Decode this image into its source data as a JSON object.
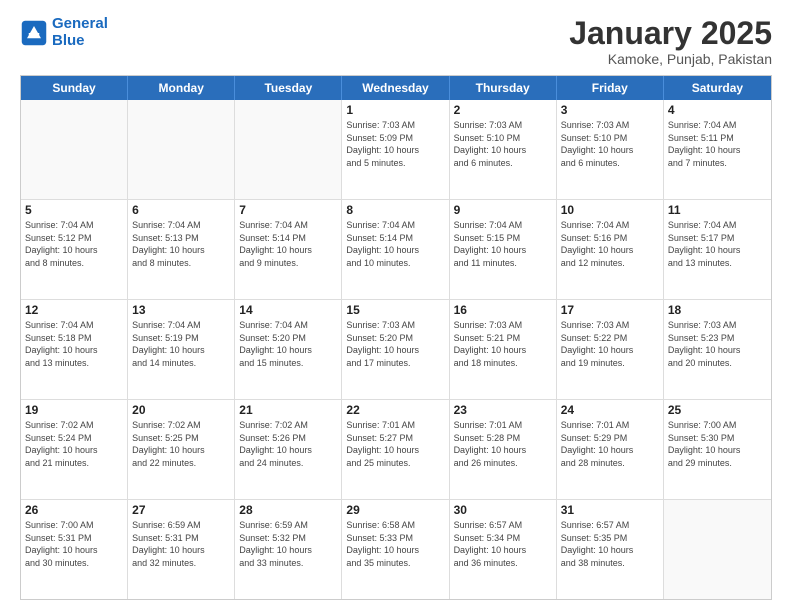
{
  "header": {
    "logo_line1": "General",
    "logo_line2": "Blue",
    "title": "January 2025",
    "subtitle": "Kamoke, Punjab, Pakistan"
  },
  "weekdays": [
    "Sunday",
    "Monday",
    "Tuesday",
    "Wednesday",
    "Thursday",
    "Friday",
    "Saturday"
  ],
  "weeks": [
    [
      {
        "day": "",
        "info": "",
        "empty": true
      },
      {
        "day": "",
        "info": "",
        "empty": true
      },
      {
        "day": "",
        "info": "",
        "empty": true
      },
      {
        "day": "1",
        "info": "Sunrise: 7:03 AM\nSunset: 5:09 PM\nDaylight: 10 hours\nand 5 minutes.",
        "empty": false
      },
      {
        "day": "2",
        "info": "Sunrise: 7:03 AM\nSunset: 5:10 PM\nDaylight: 10 hours\nand 6 minutes.",
        "empty": false
      },
      {
        "day": "3",
        "info": "Sunrise: 7:03 AM\nSunset: 5:10 PM\nDaylight: 10 hours\nand 6 minutes.",
        "empty": false
      },
      {
        "day": "4",
        "info": "Sunrise: 7:04 AM\nSunset: 5:11 PM\nDaylight: 10 hours\nand 7 minutes.",
        "empty": false
      }
    ],
    [
      {
        "day": "5",
        "info": "Sunrise: 7:04 AM\nSunset: 5:12 PM\nDaylight: 10 hours\nand 8 minutes.",
        "empty": false
      },
      {
        "day": "6",
        "info": "Sunrise: 7:04 AM\nSunset: 5:13 PM\nDaylight: 10 hours\nand 8 minutes.",
        "empty": false
      },
      {
        "day": "7",
        "info": "Sunrise: 7:04 AM\nSunset: 5:14 PM\nDaylight: 10 hours\nand 9 minutes.",
        "empty": false
      },
      {
        "day": "8",
        "info": "Sunrise: 7:04 AM\nSunset: 5:14 PM\nDaylight: 10 hours\nand 10 minutes.",
        "empty": false
      },
      {
        "day": "9",
        "info": "Sunrise: 7:04 AM\nSunset: 5:15 PM\nDaylight: 10 hours\nand 11 minutes.",
        "empty": false
      },
      {
        "day": "10",
        "info": "Sunrise: 7:04 AM\nSunset: 5:16 PM\nDaylight: 10 hours\nand 12 minutes.",
        "empty": false
      },
      {
        "day": "11",
        "info": "Sunrise: 7:04 AM\nSunset: 5:17 PM\nDaylight: 10 hours\nand 13 minutes.",
        "empty": false
      }
    ],
    [
      {
        "day": "12",
        "info": "Sunrise: 7:04 AM\nSunset: 5:18 PM\nDaylight: 10 hours\nand 13 minutes.",
        "empty": false
      },
      {
        "day": "13",
        "info": "Sunrise: 7:04 AM\nSunset: 5:19 PM\nDaylight: 10 hours\nand 14 minutes.",
        "empty": false
      },
      {
        "day": "14",
        "info": "Sunrise: 7:04 AM\nSunset: 5:20 PM\nDaylight: 10 hours\nand 15 minutes.",
        "empty": false
      },
      {
        "day": "15",
        "info": "Sunrise: 7:03 AM\nSunset: 5:20 PM\nDaylight: 10 hours\nand 17 minutes.",
        "empty": false
      },
      {
        "day": "16",
        "info": "Sunrise: 7:03 AM\nSunset: 5:21 PM\nDaylight: 10 hours\nand 18 minutes.",
        "empty": false
      },
      {
        "day": "17",
        "info": "Sunrise: 7:03 AM\nSunset: 5:22 PM\nDaylight: 10 hours\nand 19 minutes.",
        "empty": false
      },
      {
        "day": "18",
        "info": "Sunrise: 7:03 AM\nSunset: 5:23 PM\nDaylight: 10 hours\nand 20 minutes.",
        "empty": false
      }
    ],
    [
      {
        "day": "19",
        "info": "Sunrise: 7:02 AM\nSunset: 5:24 PM\nDaylight: 10 hours\nand 21 minutes.",
        "empty": false
      },
      {
        "day": "20",
        "info": "Sunrise: 7:02 AM\nSunset: 5:25 PM\nDaylight: 10 hours\nand 22 minutes.",
        "empty": false
      },
      {
        "day": "21",
        "info": "Sunrise: 7:02 AM\nSunset: 5:26 PM\nDaylight: 10 hours\nand 24 minutes.",
        "empty": false
      },
      {
        "day": "22",
        "info": "Sunrise: 7:01 AM\nSunset: 5:27 PM\nDaylight: 10 hours\nand 25 minutes.",
        "empty": false
      },
      {
        "day": "23",
        "info": "Sunrise: 7:01 AM\nSunset: 5:28 PM\nDaylight: 10 hours\nand 26 minutes.",
        "empty": false
      },
      {
        "day": "24",
        "info": "Sunrise: 7:01 AM\nSunset: 5:29 PM\nDaylight: 10 hours\nand 28 minutes.",
        "empty": false
      },
      {
        "day": "25",
        "info": "Sunrise: 7:00 AM\nSunset: 5:30 PM\nDaylight: 10 hours\nand 29 minutes.",
        "empty": false
      }
    ],
    [
      {
        "day": "26",
        "info": "Sunrise: 7:00 AM\nSunset: 5:31 PM\nDaylight: 10 hours\nand 30 minutes.",
        "empty": false
      },
      {
        "day": "27",
        "info": "Sunrise: 6:59 AM\nSunset: 5:31 PM\nDaylight: 10 hours\nand 32 minutes.",
        "empty": false
      },
      {
        "day": "28",
        "info": "Sunrise: 6:59 AM\nSunset: 5:32 PM\nDaylight: 10 hours\nand 33 minutes.",
        "empty": false
      },
      {
        "day": "29",
        "info": "Sunrise: 6:58 AM\nSunset: 5:33 PM\nDaylight: 10 hours\nand 35 minutes.",
        "empty": false
      },
      {
        "day": "30",
        "info": "Sunrise: 6:57 AM\nSunset: 5:34 PM\nDaylight: 10 hours\nand 36 minutes.",
        "empty": false
      },
      {
        "day": "31",
        "info": "Sunrise: 6:57 AM\nSunset: 5:35 PM\nDaylight: 10 hours\nand 38 minutes.",
        "empty": false
      },
      {
        "day": "",
        "info": "",
        "empty": true
      }
    ]
  ]
}
